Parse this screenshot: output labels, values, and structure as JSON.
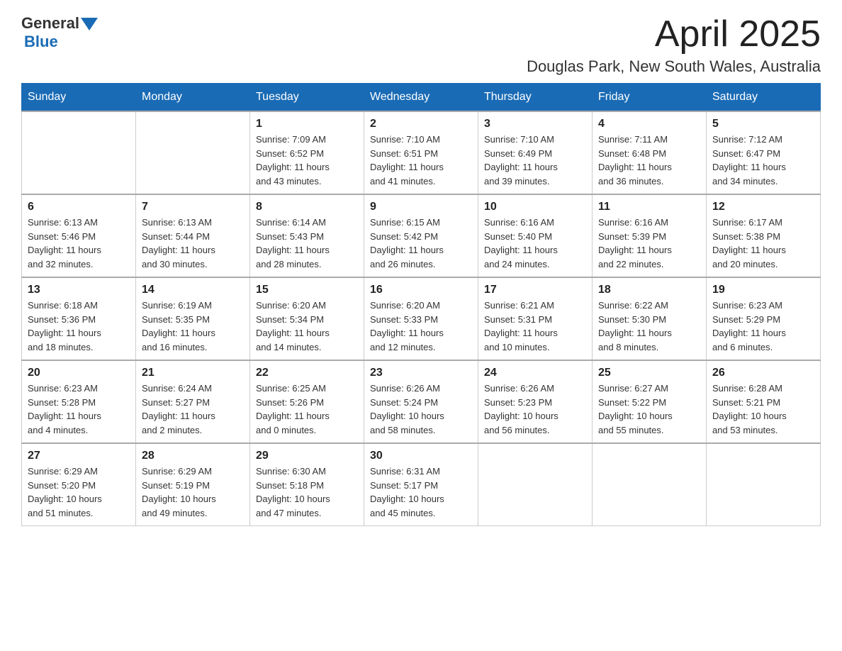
{
  "header": {
    "logo_general": "General",
    "logo_blue": "Blue",
    "month": "April 2025",
    "location": "Douglas Park, New South Wales, Australia"
  },
  "days_of_week": [
    "Sunday",
    "Monday",
    "Tuesday",
    "Wednesday",
    "Thursday",
    "Friday",
    "Saturday"
  ],
  "weeks": [
    [
      {
        "day": "",
        "info": ""
      },
      {
        "day": "",
        "info": ""
      },
      {
        "day": "1",
        "info": "Sunrise: 7:09 AM\nSunset: 6:52 PM\nDaylight: 11 hours\nand 43 minutes."
      },
      {
        "day": "2",
        "info": "Sunrise: 7:10 AM\nSunset: 6:51 PM\nDaylight: 11 hours\nand 41 minutes."
      },
      {
        "day": "3",
        "info": "Sunrise: 7:10 AM\nSunset: 6:49 PM\nDaylight: 11 hours\nand 39 minutes."
      },
      {
        "day": "4",
        "info": "Sunrise: 7:11 AM\nSunset: 6:48 PM\nDaylight: 11 hours\nand 36 minutes."
      },
      {
        "day": "5",
        "info": "Sunrise: 7:12 AM\nSunset: 6:47 PM\nDaylight: 11 hours\nand 34 minutes."
      }
    ],
    [
      {
        "day": "6",
        "info": "Sunrise: 6:13 AM\nSunset: 5:46 PM\nDaylight: 11 hours\nand 32 minutes."
      },
      {
        "day": "7",
        "info": "Sunrise: 6:13 AM\nSunset: 5:44 PM\nDaylight: 11 hours\nand 30 minutes."
      },
      {
        "day": "8",
        "info": "Sunrise: 6:14 AM\nSunset: 5:43 PM\nDaylight: 11 hours\nand 28 minutes."
      },
      {
        "day": "9",
        "info": "Sunrise: 6:15 AM\nSunset: 5:42 PM\nDaylight: 11 hours\nand 26 minutes."
      },
      {
        "day": "10",
        "info": "Sunrise: 6:16 AM\nSunset: 5:40 PM\nDaylight: 11 hours\nand 24 minutes."
      },
      {
        "day": "11",
        "info": "Sunrise: 6:16 AM\nSunset: 5:39 PM\nDaylight: 11 hours\nand 22 minutes."
      },
      {
        "day": "12",
        "info": "Sunrise: 6:17 AM\nSunset: 5:38 PM\nDaylight: 11 hours\nand 20 minutes."
      }
    ],
    [
      {
        "day": "13",
        "info": "Sunrise: 6:18 AM\nSunset: 5:36 PM\nDaylight: 11 hours\nand 18 minutes."
      },
      {
        "day": "14",
        "info": "Sunrise: 6:19 AM\nSunset: 5:35 PM\nDaylight: 11 hours\nand 16 minutes."
      },
      {
        "day": "15",
        "info": "Sunrise: 6:20 AM\nSunset: 5:34 PM\nDaylight: 11 hours\nand 14 minutes."
      },
      {
        "day": "16",
        "info": "Sunrise: 6:20 AM\nSunset: 5:33 PM\nDaylight: 11 hours\nand 12 minutes."
      },
      {
        "day": "17",
        "info": "Sunrise: 6:21 AM\nSunset: 5:31 PM\nDaylight: 11 hours\nand 10 minutes."
      },
      {
        "day": "18",
        "info": "Sunrise: 6:22 AM\nSunset: 5:30 PM\nDaylight: 11 hours\nand 8 minutes."
      },
      {
        "day": "19",
        "info": "Sunrise: 6:23 AM\nSunset: 5:29 PM\nDaylight: 11 hours\nand 6 minutes."
      }
    ],
    [
      {
        "day": "20",
        "info": "Sunrise: 6:23 AM\nSunset: 5:28 PM\nDaylight: 11 hours\nand 4 minutes."
      },
      {
        "day": "21",
        "info": "Sunrise: 6:24 AM\nSunset: 5:27 PM\nDaylight: 11 hours\nand 2 minutes."
      },
      {
        "day": "22",
        "info": "Sunrise: 6:25 AM\nSunset: 5:26 PM\nDaylight: 11 hours\nand 0 minutes."
      },
      {
        "day": "23",
        "info": "Sunrise: 6:26 AM\nSunset: 5:24 PM\nDaylight: 10 hours\nand 58 minutes."
      },
      {
        "day": "24",
        "info": "Sunrise: 6:26 AM\nSunset: 5:23 PM\nDaylight: 10 hours\nand 56 minutes."
      },
      {
        "day": "25",
        "info": "Sunrise: 6:27 AM\nSunset: 5:22 PM\nDaylight: 10 hours\nand 55 minutes."
      },
      {
        "day": "26",
        "info": "Sunrise: 6:28 AM\nSunset: 5:21 PM\nDaylight: 10 hours\nand 53 minutes."
      }
    ],
    [
      {
        "day": "27",
        "info": "Sunrise: 6:29 AM\nSunset: 5:20 PM\nDaylight: 10 hours\nand 51 minutes."
      },
      {
        "day": "28",
        "info": "Sunrise: 6:29 AM\nSunset: 5:19 PM\nDaylight: 10 hours\nand 49 minutes."
      },
      {
        "day": "29",
        "info": "Sunrise: 6:30 AM\nSunset: 5:18 PM\nDaylight: 10 hours\nand 47 minutes."
      },
      {
        "day": "30",
        "info": "Sunrise: 6:31 AM\nSunset: 5:17 PM\nDaylight: 10 hours\nand 45 minutes."
      },
      {
        "day": "",
        "info": ""
      },
      {
        "day": "",
        "info": ""
      },
      {
        "day": "",
        "info": ""
      }
    ]
  ]
}
